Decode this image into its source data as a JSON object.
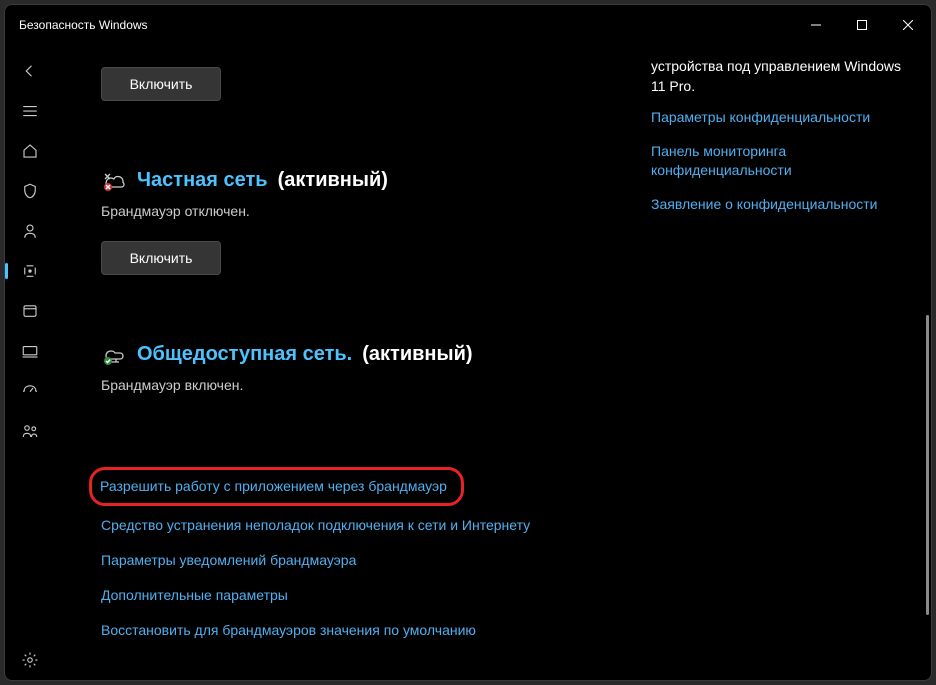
{
  "window": {
    "title": "Безопасность Windows"
  },
  "top_button": "Включить",
  "sections": {
    "private": {
      "title": "Частная сеть",
      "suffix": "(активный)",
      "desc": "Брандмауэр отключен.",
      "button": "Включить"
    },
    "public": {
      "title": "Общедоступная сеть.",
      "suffix": "(активный)",
      "desc": "Брандмауэр включен."
    }
  },
  "links": {
    "allow_app": "Разрешить работу с приложением через брандмауэр",
    "troubleshoot": "Средство устранения неполадок подключения к сети и Интернету",
    "notifications": "Параметры уведомлений брандмауэра",
    "advanced": "Дополнительные параметры",
    "restore": "Восстановить для брандмауэров значения по умолчанию"
  },
  "sidebar": {
    "device_info": "устройства под управлением Windows 11 Pro.",
    "privacy_settings": "Параметры конфиденциальности",
    "privacy_dashboard": "Панель мониторинга конфиденциальности",
    "privacy_statement": "Заявление о конфиденциальности"
  }
}
